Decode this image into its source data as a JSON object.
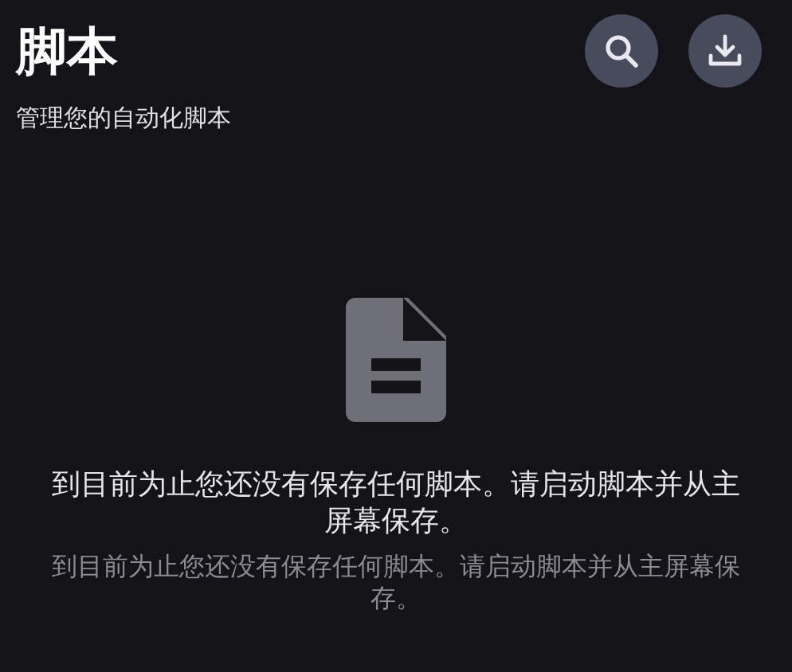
{
  "header": {
    "title": "脚本",
    "subtitle": "管理您的自动化脚本"
  },
  "actions": [
    {
      "kind": "search"
    },
    {
      "kind": "import"
    }
  ],
  "empty_state": {
    "message": "到目前为止您还没有保存任何脚本。请启动脚本并从主屏幕保存。",
    "detail": "到目前为止您还没有保存任何脚本。请启动脚本并从主屏幕保存。"
  }
}
